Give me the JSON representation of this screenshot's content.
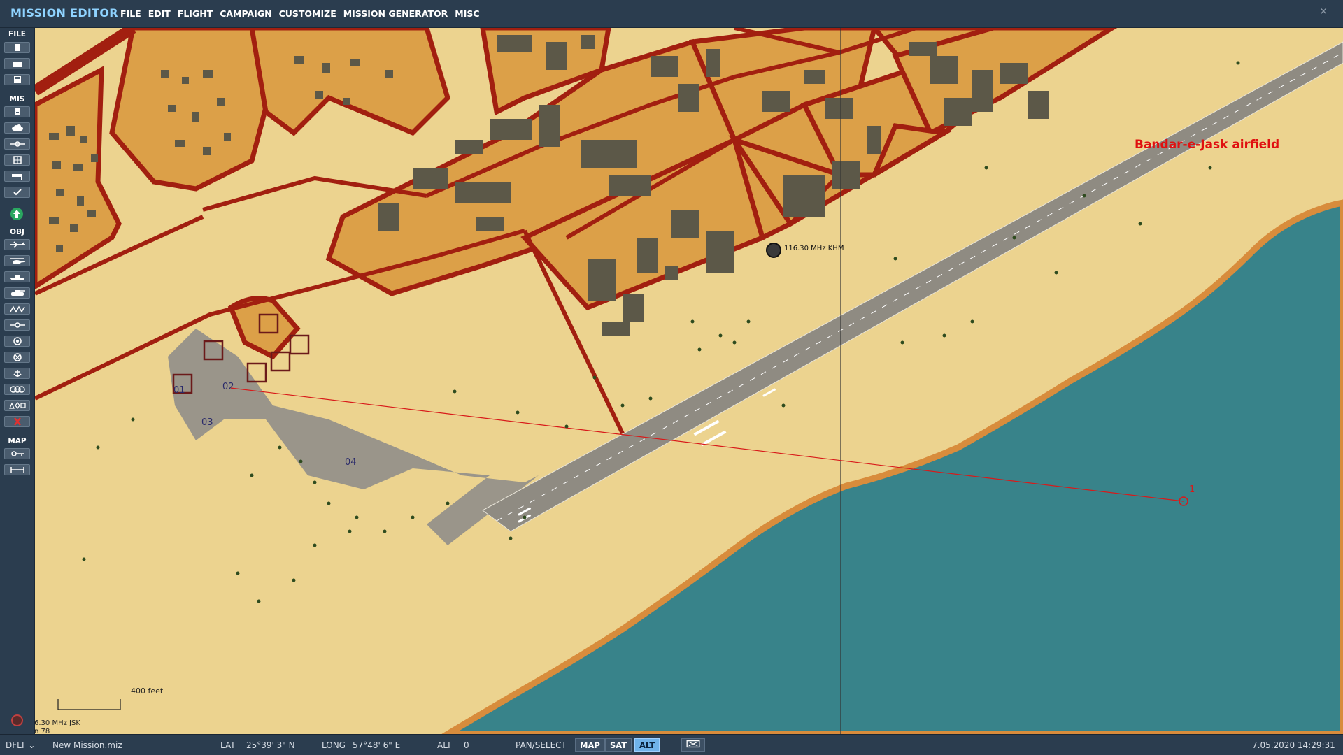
{
  "app": {
    "title": "MISSION EDITOR",
    "close_glyph": "✕"
  },
  "menu": [
    "FILE",
    "EDIT",
    "FLIGHT",
    "CAMPAIGN",
    "CUSTOMIZE",
    "MISSION GENERATOR",
    "MISC"
  ],
  "toolbar": {
    "sections": [
      "FILE",
      "MIS",
      "OBJ",
      "MAP"
    ],
    "file_tools": [
      "new-file-icon",
      "open-folder-icon",
      "save-disk-icon"
    ],
    "mis_tools": [
      "briefing-clipboard-icon",
      "weather-cloud-icon",
      "triggers-icon",
      "goals-target-icon",
      "flag-icon",
      "check-icon",
      "green-up-arrow-icon"
    ],
    "obj_tools": [
      "plane-icon",
      "helicopter-icon",
      "ship-icon",
      "ground-vehicle-icon",
      "static-object-icon",
      "waypoint-line-icon",
      "trigger-zone-icon",
      "target-circle-icon",
      "ship-anchor-icon",
      "airfield-icon",
      "template-shapes-icon",
      "delete-x-icon"
    ],
    "map_tools": [
      "map-options-icon",
      "ruler-icon"
    ]
  },
  "map": {
    "airfield_name": "Bandar-e-Jask airfield",
    "beacon_label": "116.30 MHz KHM",
    "waypoint_label": "1",
    "parking_numbers": [
      "01",
      "02",
      "03",
      "04"
    ],
    "scale_label": "400 feet",
    "corner_beacon_line1": "6.30 MHz JSK",
    "corner_beacon_line2": "n 78",
    "colors": {
      "sand": "#ecd38f",
      "urban": "#dca048",
      "road": "#a21f10",
      "building": "#5c5848",
      "sea": "#38838a",
      "tarmac": "#9a958a"
    }
  },
  "status": {
    "coalition": "DFLT",
    "mission_file": "New Mission.miz",
    "lat_label": "LAT",
    "lat_value": "25°39' 3\" N",
    "long_label": "LONG",
    "long_value": "57°48' 6\" E",
    "alt_label": "ALT",
    "alt_value": "0",
    "mode": "PAN/SELECT",
    "view_buttons": [
      "MAP",
      "SAT",
      "ALT"
    ],
    "active_view": "ALT",
    "datetime": "7.05.2020 14:29:31"
  }
}
